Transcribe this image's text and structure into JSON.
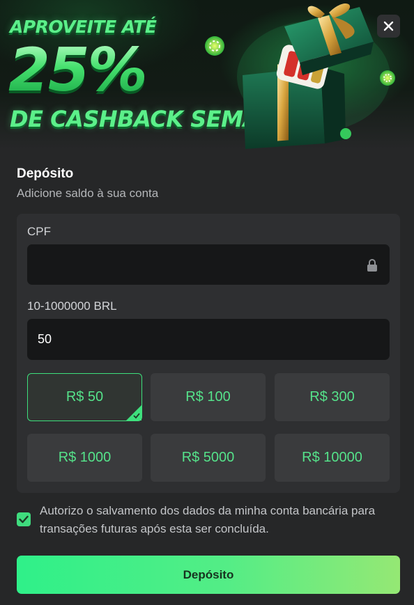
{
  "banner": {
    "line1": "APROVEITE ATÉ",
    "line2": "25%",
    "line3": "DE CASHBACK SEMANAL"
  },
  "close": {
    "icon": "close-icon"
  },
  "deposit": {
    "title": "Depósito",
    "subtitle": "Adicione saldo à sua conta"
  },
  "form": {
    "cpf_label": "CPF",
    "cpf_value": "",
    "cpf_icon": "lock-icon",
    "amount_label": "10-1000000 BRL",
    "amount_value": "50",
    "presets": [
      {
        "label": "R$ 50",
        "selected": true
      },
      {
        "label": "R$ 100",
        "selected": false
      },
      {
        "label": "R$ 300",
        "selected": false
      },
      {
        "label": "R$ 1000",
        "selected": false
      },
      {
        "label": "R$ 5000",
        "selected": false
      },
      {
        "label": "R$ 10000",
        "selected": false
      }
    ]
  },
  "consent": {
    "checked": true,
    "text": "Autorizo o salvamento dos dados da minha conta bancária para transações futuras após esta ser concluída."
  },
  "submit": {
    "label": "Depósito"
  },
  "colors": {
    "accent": "#3ee07d",
    "preset_text": "#55e28a",
    "background": "#262728",
    "card": "#2e2f31",
    "input": "#161718"
  }
}
